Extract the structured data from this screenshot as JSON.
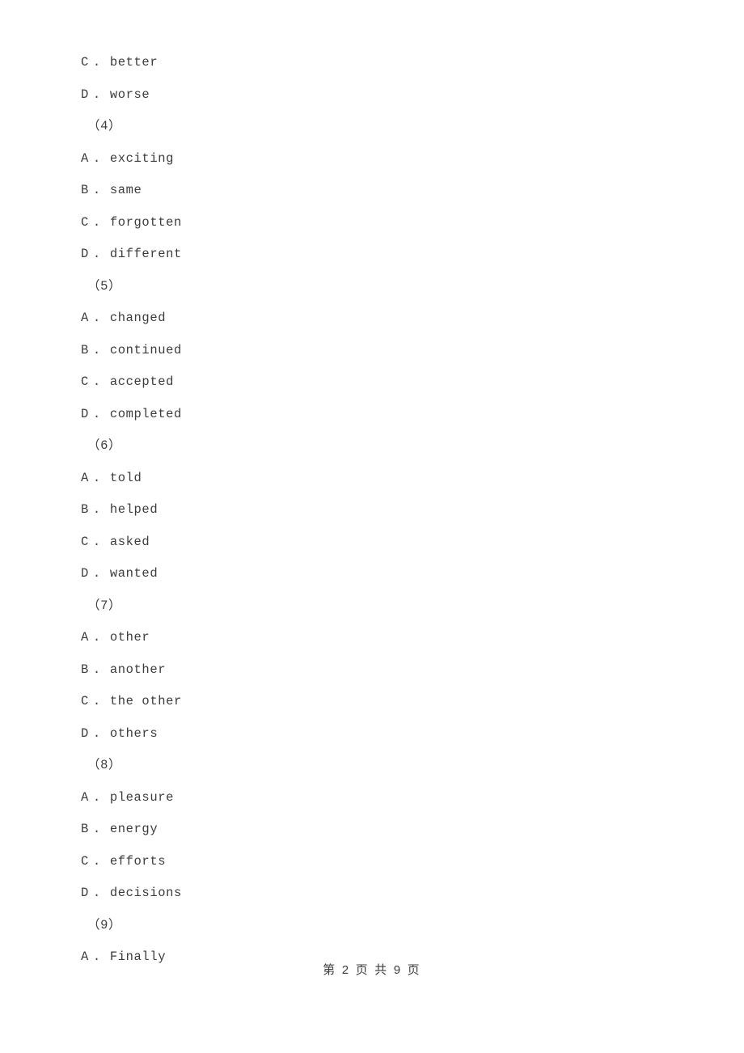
{
  "document": {
    "page_footer": "第 2 页 共 9 页",
    "lines": [
      {
        "kind": "option",
        "letter": "C",
        "dot": ".",
        "text": "better"
      },
      {
        "kind": "option",
        "letter": "D",
        "dot": ".",
        "text": "worse"
      },
      {
        "kind": "question",
        "text": "（4）"
      },
      {
        "kind": "option",
        "letter": "A",
        "dot": ".",
        "text": "exciting"
      },
      {
        "kind": "option",
        "letter": "B",
        "dot": ".",
        "text": "same"
      },
      {
        "kind": "option",
        "letter": "C",
        "dot": ".",
        "text": "forgotten"
      },
      {
        "kind": "option",
        "letter": "D",
        "dot": ".",
        "text": "different"
      },
      {
        "kind": "question",
        "text": "（5）"
      },
      {
        "kind": "option",
        "letter": "A",
        "dot": ".",
        "text": "changed"
      },
      {
        "kind": "option",
        "letter": "B",
        "dot": ".",
        "text": "continued"
      },
      {
        "kind": "option",
        "letter": "C",
        "dot": ".",
        "text": "accepted"
      },
      {
        "kind": "option",
        "letter": "D",
        "dot": ".",
        "text": "completed"
      },
      {
        "kind": "question",
        "text": "（6）"
      },
      {
        "kind": "option",
        "letter": "A",
        "dot": ".",
        "text": "told"
      },
      {
        "kind": "option",
        "letter": "B",
        "dot": ".",
        "text": "helped"
      },
      {
        "kind": "option",
        "letter": "C",
        "dot": ".",
        "text": "asked"
      },
      {
        "kind": "option",
        "letter": "D",
        "dot": ".",
        "text": "wanted"
      },
      {
        "kind": "question",
        "text": "（7）"
      },
      {
        "kind": "option",
        "letter": "A",
        "dot": ".",
        "text": "other"
      },
      {
        "kind": "option",
        "letter": "B",
        "dot": ".",
        "text": "another"
      },
      {
        "kind": "option",
        "letter": "C",
        "dot": ".",
        "text": "the other"
      },
      {
        "kind": "option",
        "letter": "D",
        "dot": ".",
        "text": "others"
      },
      {
        "kind": "question",
        "text": "（8）"
      },
      {
        "kind": "option",
        "letter": "A",
        "dot": ".",
        "text": "pleasure"
      },
      {
        "kind": "option",
        "letter": "B",
        "dot": ".",
        "text": "energy"
      },
      {
        "kind": "option",
        "letter": "C",
        "dot": ".",
        "text": "efforts"
      },
      {
        "kind": "option",
        "letter": "D",
        "dot": ".",
        "text": "decisions"
      },
      {
        "kind": "question",
        "text": "（9）"
      },
      {
        "kind": "option",
        "letter": "A",
        "dot": ".",
        "text": "Finally"
      }
    ]
  }
}
